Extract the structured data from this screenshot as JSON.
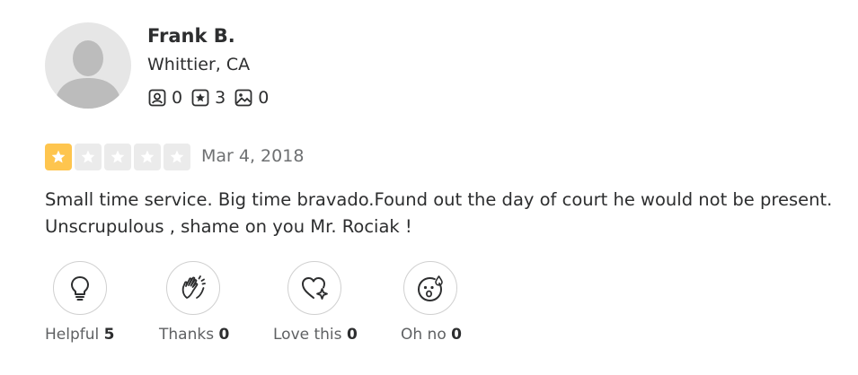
{
  "user": {
    "name": "Frank B.",
    "location": "Whittier, CA",
    "stats": {
      "friends": {
        "icon": "friends-icon",
        "count": "0"
      },
      "reviews": {
        "icon": "review-star-icon",
        "count": "3"
      },
      "photos": {
        "icon": "photo-icon",
        "count": "0"
      }
    }
  },
  "review": {
    "rating": 1,
    "max_rating": 5,
    "date": "Mar 4, 2018",
    "text": "Small time service. Big time bravado.Found out the day of court he would not be present. Unscrupulous , shame on you Mr. Rociak !"
  },
  "reactions": [
    {
      "icon": "lightbulb-icon",
      "label": "Helpful",
      "count": "5"
    },
    {
      "icon": "waving-hands-icon",
      "label": "Thanks",
      "count": "0"
    },
    {
      "icon": "heart-sparkle-icon",
      "label": "Love this",
      "count": "0"
    },
    {
      "icon": "oh-no-face-icon",
      "label": "Oh no",
      "count": "0"
    }
  ],
  "colors": {
    "star_filled": "#fec54e",
    "star_empty": "#ebebeb",
    "text": "#2d2e2f",
    "muted": "#6e7072"
  }
}
